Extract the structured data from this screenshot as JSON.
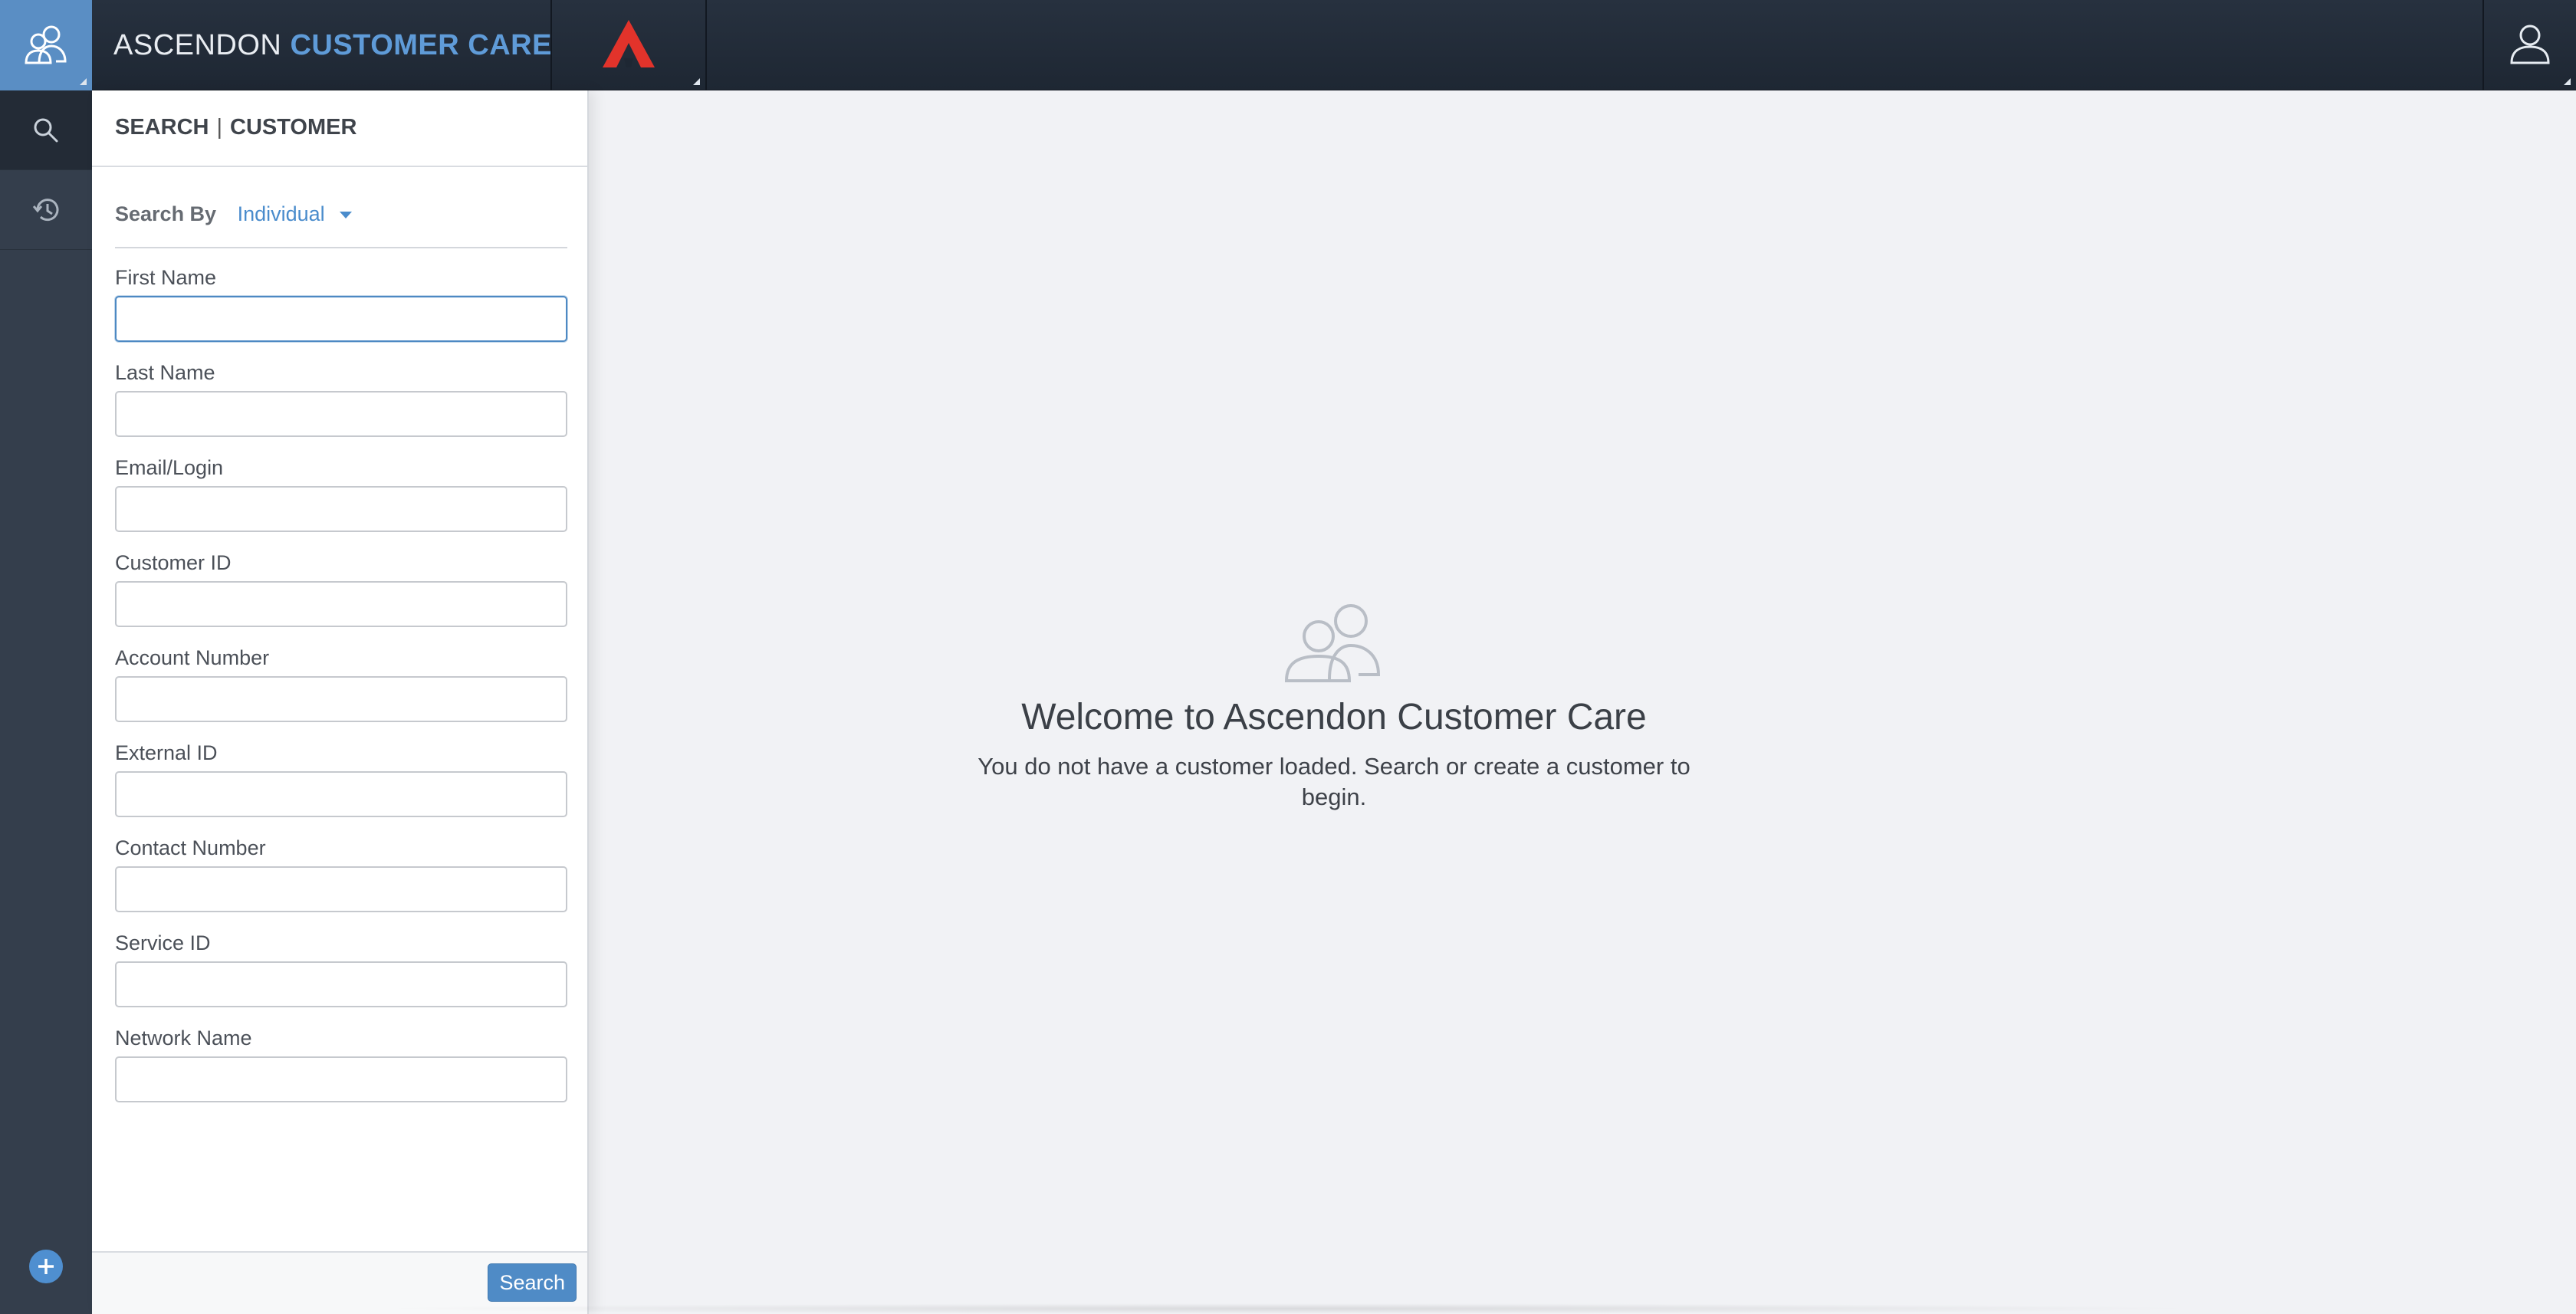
{
  "header": {
    "brand_primary": "ASCENDON",
    "brand_accent": "CUSTOMER CARE"
  },
  "icons": {
    "customers": "customers-icon",
    "brand_logo": "ascendon-logo-icon",
    "user": "user-profile-icon",
    "search": "search-icon",
    "history": "history-icon",
    "add": "add-circle-icon"
  },
  "panel": {
    "title": "SEARCH",
    "separator": "|",
    "subtitle": "CUSTOMER",
    "search_by_label": "Search By",
    "search_by_value": "Individual",
    "fields": [
      {
        "label": "First Name",
        "value": ""
      },
      {
        "label": "Last Name",
        "value": ""
      },
      {
        "label": "Email/Login",
        "value": ""
      },
      {
        "label": "Customer ID",
        "value": ""
      },
      {
        "label": "Account Number",
        "value": ""
      },
      {
        "label": "External ID",
        "value": ""
      },
      {
        "label": "Contact Number",
        "value": ""
      },
      {
        "label": "Service ID",
        "value": ""
      },
      {
        "label": "Network Name",
        "value": ""
      }
    ],
    "search_button": "Search"
  },
  "main": {
    "welcome_title": "Welcome to Ascendon Customer Care",
    "welcome_message": "You do not have a customer loaded. Search or create a customer to begin."
  },
  "colors": {
    "accent": "#5a8ec4",
    "header_bg": "#232c38",
    "logo_red": "#e2332b"
  }
}
